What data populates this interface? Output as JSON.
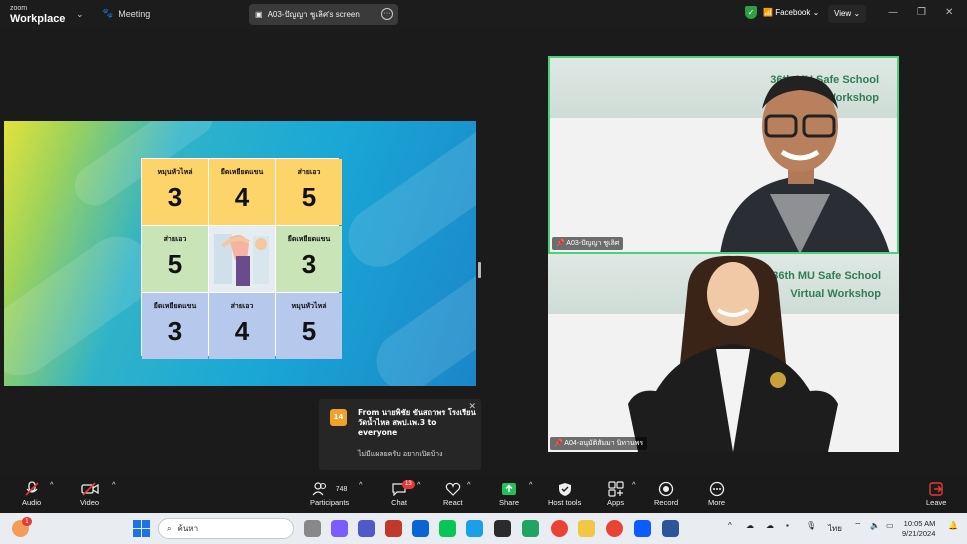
{
  "titlebar": {
    "brand_small": "zoom",
    "brand_large": "Workplace",
    "meeting_label": "Meeting",
    "shared_screen_label": "A03-ปัญญา ชูเลิศ's screen",
    "live_label": "Facebook",
    "view_label": "View"
  },
  "slide": {
    "cells": [
      {
        "label": "หมุนหัวไหล่",
        "number": "3"
      },
      {
        "label": "ยืดเหยียดแขน",
        "number": "4"
      },
      {
        "label": "ส่ายเอว",
        "number": "5"
      },
      {
        "label": "ส่ายเอว",
        "number": "5"
      },
      {
        "label": "",
        "number": ""
      },
      {
        "label": "ยืดเหยียดแขน",
        "number": "3"
      },
      {
        "label": "ยืดเหยียดแขน",
        "number": "3"
      },
      {
        "label": "ส่ายเอว",
        "number": "4"
      },
      {
        "label": "หมุนหัวไหล่",
        "number": "5"
      }
    ]
  },
  "tiles": {
    "banner_line1": "36th MU Safe School",
    "banner_line2": "Virtual Workshop",
    "tile1_name": "A03-ปัญญา ชูเลิศ",
    "tile2_name": "A04-อนุมัติสัมมา นิทานพร"
  },
  "notification": {
    "avatar": "14",
    "from": "From นายพิชัย ขันสถาพร โรงเรียนวัดน้ำไหล สพป.เพ.3 to everyone",
    "message": "ไม่มีแผลยครับ อยากเปิดบ้าง"
  },
  "toolbar": {
    "audio": "Audio",
    "video": "Video",
    "participants": "Participants",
    "participants_count": "748",
    "chat": "Chat",
    "chat_badge": "13",
    "react": "React",
    "share": "Share",
    "host_tools": "Host tools",
    "apps": "Apps",
    "record": "Record",
    "more": "More",
    "leave": "Leave"
  },
  "taskbar": {
    "search_placeholder": "ค้นหา",
    "notify_badge": "1",
    "lang": "ไทย",
    "time": "10:05 AM",
    "date": "9/21/2024"
  },
  "colors": {
    "accent_green": "#4ad17a",
    "leave_red": "#e53935",
    "share_green": "#23c05a"
  }
}
